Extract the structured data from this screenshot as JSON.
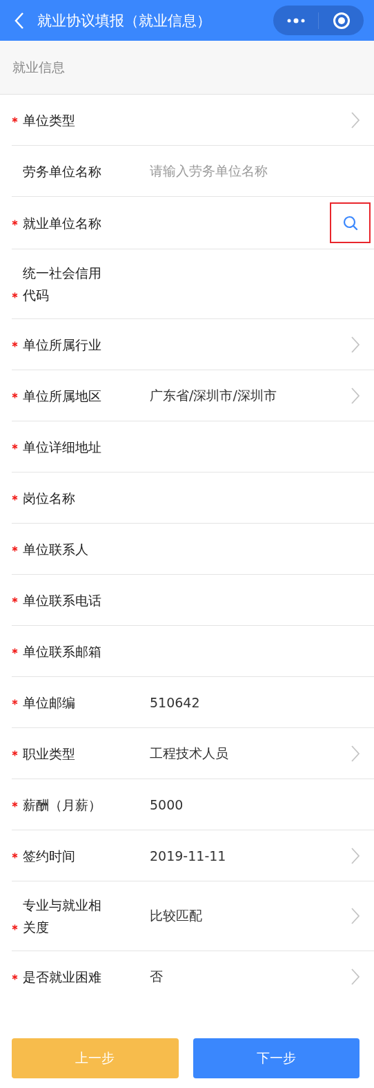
{
  "nav": {
    "title": "就业协议填报（就业信息）"
  },
  "section": {
    "title": "就业信息"
  },
  "rows": [
    {
      "label": "单位类型",
      "required": true,
      "kind": "select"
    },
    {
      "label": "劳务单位名称",
      "required": false,
      "kind": "input",
      "placeholder": "请输入劳务单位名称"
    },
    {
      "label": "就业单位名称",
      "required": true,
      "kind": "search",
      "highlighted": true
    },
    {
      "label": "统一社会信用代码",
      "required": true,
      "kind": "input"
    },
    {
      "label": "单位所属行业",
      "required": true,
      "kind": "select"
    },
    {
      "label": "单位所属地区",
      "required": true,
      "kind": "select",
      "value": "广东省/深圳市/深圳市"
    },
    {
      "label": "单位详细地址",
      "required": true,
      "kind": "input"
    },
    {
      "label": "岗位名称",
      "required": true,
      "kind": "input"
    },
    {
      "label": "单位联系人",
      "required": true,
      "kind": "input"
    },
    {
      "label": "单位联系电话",
      "required": true,
      "kind": "input"
    },
    {
      "label": "单位联系邮箱",
      "required": true,
      "kind": "input"
    },
    {
      "label": "单位邮编",
      "required": true,
      "kind": "input",
      "value": "510642"
    },
    {
      "label": "职业类型",
      "required": true,
      "kind": "select",
      "value": "工程技术人员"
    },
    {
      "label": "薪酬（月薪）",
      "required": true,
      "kind": "input",
      "value": "5000"
    },
    {
      "label": "签约时间",
      "required": true,
      "kind": "select",
      "value": "2019-11-11"
    },
    {
      "label": "专业与就业相关度",
      "required": true,
      "kind": "select",
      "value": "比较匹配"
    },
    {
      "label": "是否就业困难",
      "required": true,
      "kind": "select",
      "value": "否"
    }
  ],
  "buttons": [
    {
      "label": "上一步",
      "kind": "secondary"
    },
    {
      "label": "下一步",
      "kind": "primary"
    }
  ]
}
